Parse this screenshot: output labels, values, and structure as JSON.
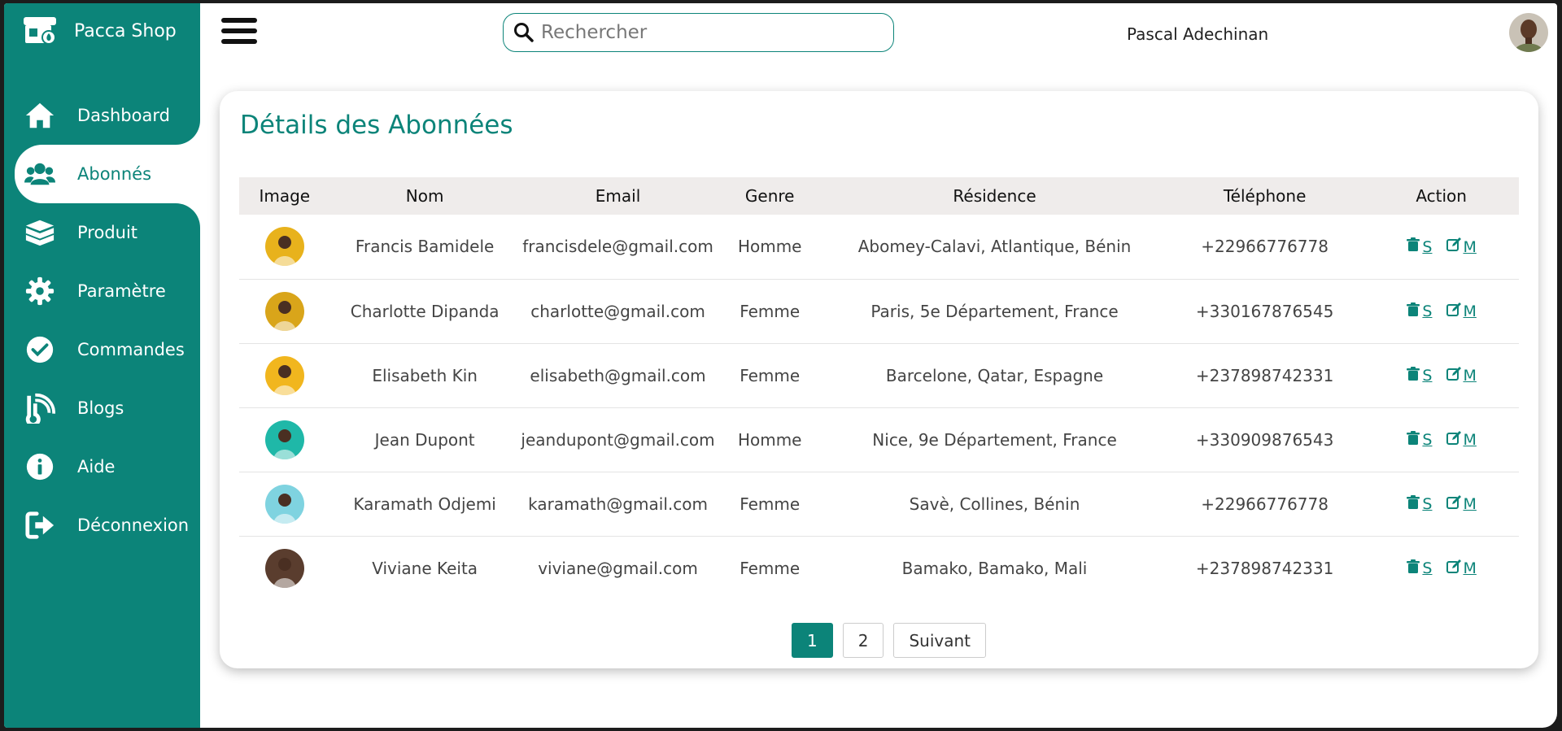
{
  "brand": {
    "name": "Pacca Shop",
    "icon": "shop-icon"
  },
  "sidebar": {
    "items": [
      {
        "label": "Dashboard",
        "icon": "home-icon"
      },
      {
        "label": "Abonnés",
        "icon": "users-icon",
        "active": true
      },
      {
        "label": "Produit",
        "icon": "box-icon"
      },
      {
        "label": "Paramètre",
        "icon": "gear-icon"
      },
      {
        "label": "Commandes",
        "icon": "check-circle-icon"
      },
      {
        "label": "Blogs",
        "icon": "blog-icon"
      },
      {
        "label": "Aide",
        "icon": "info-icon"
      },
      {
        "label": "Déconnexion",
        "icon": "logout-icon"
      }
    ]
  },
  "header": {
    "search_placeholder": "Rechercher",
    "username": "Pascal Adechinan"
  },
  "main": {
    "title": "Détails des Abonnées",
    "table": {
      "columns": [
        "Image",
        "Nom",
        "Email",
        "Genre",
        "Résidence",
        "Téléphone",
        "Action"
      ],
      "rows": [
        {
          "name": "Francis Bamidele",
          "email": "francisdele@gmail.com",
          "genre": "Homme",
          "residence": "Abomey-Calavi, Atlantique, Bénin",
          "phone": "+22966776778",
          "avatar_color": "#e8b21c"
        },
        {
          "name": "Charlotte Dipanda",
          "email": "charlotte@gmail.com",
          "genre": "Femme",
          "residence": "Paris, 5e Département, France",
          "phone": "+330167876545",
          "avatar_color": "#d9a51a"
        },
        {
          "name": "Elisabeth Kin",
          "email": "elisabeth@gmail.com",
          "genre": "Femme",
          "residence": "Barcelone, Qatar, Espagne",
          "phone": "+237898742331",
          "avatar_color": "#f1b61e"
        },
        {
          "name": "Jean Dupont",
          "email": "jeandupont@gmail.com",
          "genre": "Homme",
          "residence": "Nice, 9e Département, France",
          "phone": "+330909876543",
          "avatar_color": "#1fb8a8"
        },
        {
          "name": "Karamath Odjemi",
          "email": "karamath@gmail.com",
          "genre": "Femme",
          "residence": "Savè, Collines, Bénin",
          "phone": "+22966776778",
          "avatar_color": "#7fd3e0"
        },
        {
          "name": "Viviane Keita",
          "email": "viviane@gmail.com",
          "genre": "Femme",
          "residence": "Bamako, Bamako, Mali",
          "phone": "+237898742331",
          "avatar_color": "#5a3d2e"
        }
      ],
      "action_delete": "S",
      "action_edit": "M"
    },
    "pagination": {
      "pages": [
        "1",
        "2"
      ],
      "current": "1",
      "next_label": "Suivant"
    }
  },
  "colors": {
    "primary": "#0c8479",
    "header_bg": "#efeceb"
  }
}
